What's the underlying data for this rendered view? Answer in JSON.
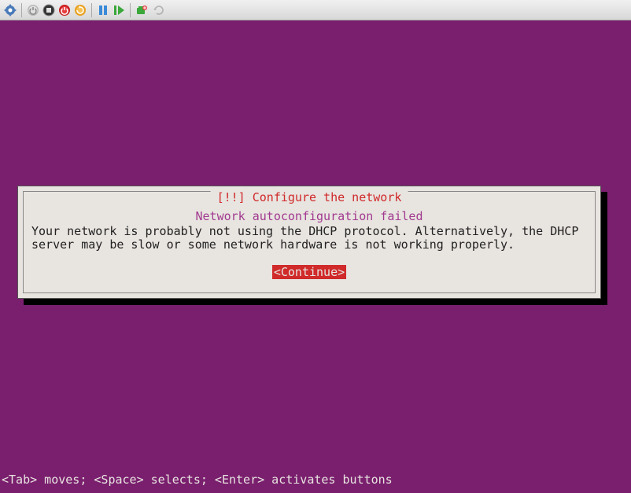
{
  "toolbar": {
    "icons": {
      "settings": "settings-icon",
      "power": "power-icon",
      "stop": "stop-icon",
      "shutdown": "shutdown-icon",
      "restart": "restart-icon",
      "pause": "pause-icon",
      "play": "play-icon",
      "snapshot": "snapshot-icon",
      "undo": "undo-icon"
    }
  },
  "dialog": {
    "title": "[!!] Configure the network",
    "heading": "Network autoconfiguration failed",
    "message": "Your network is probably not using the DHCP protocol. Alternatively, the DHCP server may be slow or some network hardware is not working properly.",
    "continue_label": "<Continue>"
  },
  "help_bar": "<Tab> moves; <Space> selects; <Enter> activates buttons",
  "colors": {
    "installer_bg": "#7a1f6e",
    "dialog_bg": "#e8e4e0",
    "title_red": "#d02a2a",
    "heading_purple": "#a13a8f",
    "button_bg": "#d02a2a"
  }
}
